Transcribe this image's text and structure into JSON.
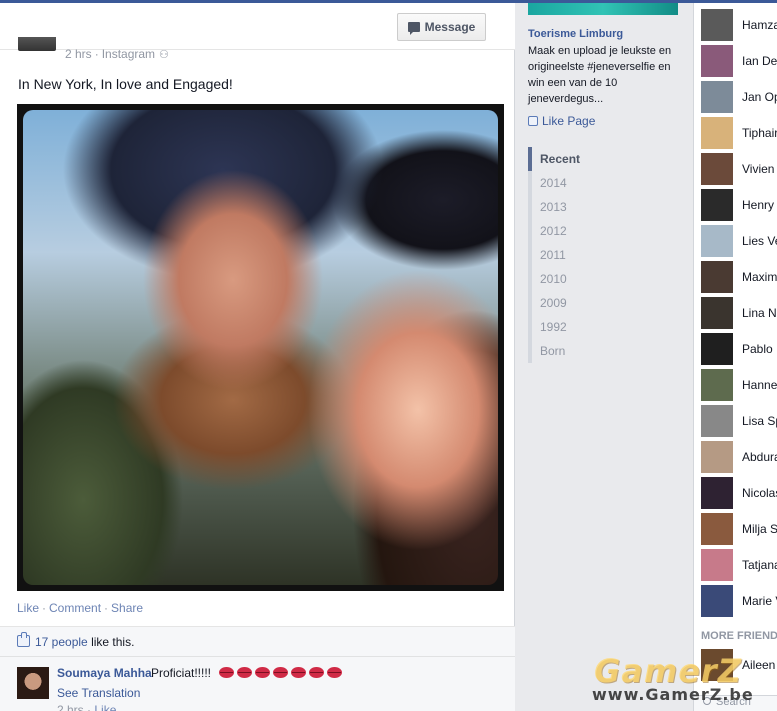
{
  "post": {
    "meta_time": "2 hrs",
    "meta_source": "Instagram",
    "message_button": "Message",
    "text": "In New York, In love and Engaged!",
    "actions": {
      "like": "Like",
      "comment": "Comment",
      "share": "Share"
    },
    "likes": {
      "count_link": "17 people",
      "suffix": "like this."
    },
    "comment": {
      "author": "Soumaya Mahha",
      "text": "Proficiat!!!!!",
      "kiss_count": 7,
      "see_translation": "See Translation",
      "time": "2 hrs",
      "like": "Like"
    }
  },
  "middle": {
    "page_name": "Toerisme Limburg",
    "page_description": "Maak en upload je leukste en origineelste #jeneverselfie en win een van de 10 jeneverdegus...",
    "like_page": "Like Page",
    "years": [
      "Recent",
      "2014",
      "2013",
      "2012",
      "2011",
      "2010",
      "2009",
      "1992",
      "Born"
    ]
  },
  "chat": {
    "friends": [
      {
        "name": "Hamza",
        "avatar": "#5a5a5a"
      },
      {
        "name": "Ian De",
        "avatar": "#8a5a7a"
      },
      {
        "name": "Jan Op",
        "avatar": "#7d8b99"
      },
      {
        "name": "Tiphair",
        "avatar": "#d8b27a"
      },
      {
        "name": "Vivien",
        "avatar": "#6b4a3a"
      },
      {
        "name": "Henry",
        "avatar": "#2a2a2a"
      },
      {
        "name": "Lies Ve",
        "avatar": "#a7b9c8"
      },
      {
        "name": "Maxim",
        "avatar": "#4a3a32"
      },
      {
        "name": "Lina Na",
        "avatar": "#3a342e"
      },
      {
        "name": "Pablo",
        "avatar": "#1f1f1f"
      },
      {
        "name": "Hanne",
        "avatar": "#5e6b4e"
      },
      {
        "name": "Lisa Sp",
        "avatar": "#888888"
      },
      {
        "name": "Abdura",
        "avatar": "#b59a84"
      },
      {
        "name": "Nicolas",
        "avatar": "#2e2232"
      },
      {
        "name": "Milja S",
        "avatar": "#8a5a3e"
      },
      {
        "name": "Tatjana",
        "avatar": "#c77a8a"
      },
      {
        "name": "Marie V",
        "avatar": "#3a4a78"
      }
    ],
    "more_friends_label": "MORE FRIENDS",
    "more_friends": [
      {
        "name": "Aileen",
        "avatar": "#6b4a2e"
      }
    ],
    "search_label": "Search"
  },
  "watermark": {
    "logo": "GamerZ",
    "url": "www.GamerZ.be"
  }
}
